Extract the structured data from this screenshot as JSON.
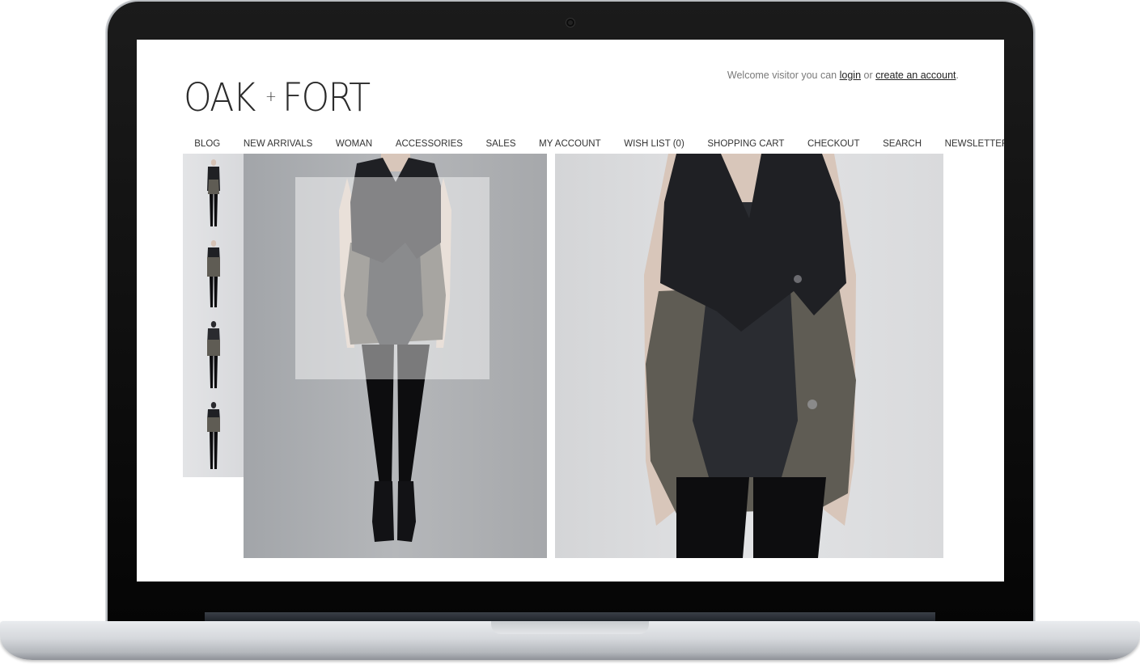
{
  "site": {
    "logo_left": "OAK",
    "logo_plus": "+",
    "logo_right": "FORT"
  },
  "header": {
    "welcome_prefix": "Welcome visitor you can",
    "login_label": "login",
    "or_text": "or",
    "create_account_label": "create an account",
    "suffix": "."
  },
  "nav": {
    "items": [
      {
        "label": "BLOG"
      },
      {
        "label": "NEW ARRIVALS"
      },
      {
        "label": "WOMAN"
      },
      {
        "label": "ACCESSORIES"
      },
      {
        "label": "SALES"
      },
      {
        "label": "MY ACCOUNT"
      },
      {
        "label": "WISH LIST (0)"
      },
      {
        "label": "SHOPPING CART"
      },
      {
        "label": "CHECKOUT"
      },
      {
        "label": "SEARCH"
      },
      {
        "label": "NEWSLETTER"
      }
    ]
  },
  "colors": {
    "vest_dark": "#1f2024",
    "jacket_olive": "#5f5c54",
    "legging": "#0d0d0f",
    "skin": "#d9c6b9"
  }
}
